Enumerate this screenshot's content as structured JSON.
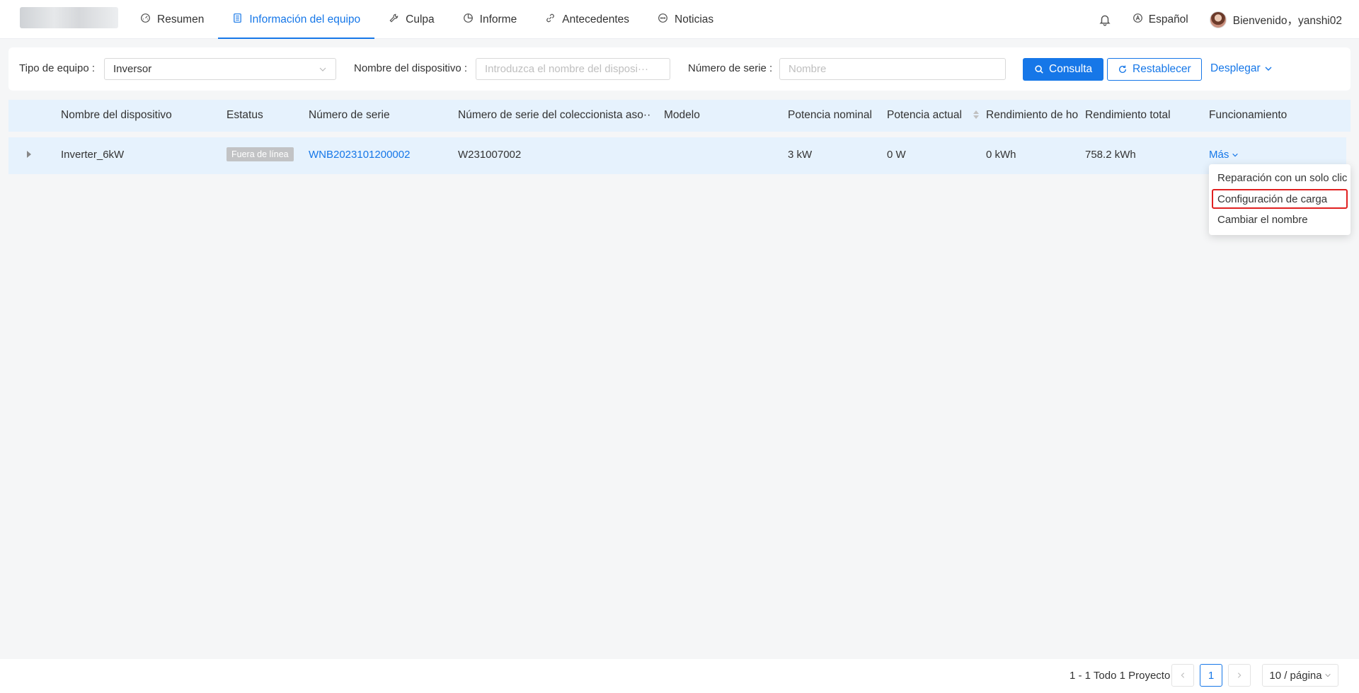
{
  "nav": {
    "items": [
      {
        "label": "Resumen",
        "icon": "gauge-icon",
        "active": false
      },
      {
        "label": "Información del equipo",
        "icon": "document-icon",
        "active": true
      },
      {
        "label": "Culpa",
        "icon": "wrench-icon",
        "active": false
      },
      {
        "label": "Informe",
        "icon": "pie-chart-icon",
        "active": false
      },
      {
        "label": "Antecedentes",
        "icon": "link-icon",
        "active": false
      },
      {
        "label": "Noticias",
        "icon": "chat-icon",
        "active": false
      }
    ]
  },
  "header": {
    "language": "Español",
    "welcome": "Bienvenido，yanshi02"
  },
  "filters": {
    "device_type_label": "Tipo de equipo :",
    "device_type_value": "Inversor",
    "device_name_label": "Nombre del dispositivo :",
    "device_name_placeholder": "Introduzca el nombre del disposi···",
    "serial_label": "Número de serie :",
    "serial_placeholder": "Nombre",
    "query_button": "Consulta",
    "reset_button": "Restablecer",
    "expand_button": "Desplegar"
  },
  "table": {
    "columns": [
      "Nombre del dispositivo",
      "Estatus",
      "Número de serie",
      "Número de serie del coleccionista aso···",
      "Modelo",
      "Potencia nominal",
      "Potencia actual",
      "Rendimiento de ho",
      "Rendimiento total",
      "Funcionamiento"
    ],
    "rows": [
      {
        "device_name": "Inverter_6kW",
        "status": "Fuera de línea",
        "serial": "WNB2023101200002",
        "collector_serial": "W231007002",
        "model": "",
        "rated_power": "3 kW",
        "current_power": "0 W",
        "daily_yield": "0 kWh",
        "total_yield": "758.2 kWh",
        "action": "Más"
      }
    ]
  },
  "dropdown": {
    "items": [
      "Reparación con un solo clic",
      "Configuración de carga",
      "Cambiar el nombre"
    ]
  },
  "pagination": {
    "total_text": "1 - 1 Todo 1 Proyecto",
    "current_page": "1",
    "page_size": "10 / página"
  },
  "colors": {
    "accent": "#1677e8",
    "row_highlight": "#e6f2fd",
    "status_offline": "#c2c3c5",
    "annotation": "#e02020"
  }
}
